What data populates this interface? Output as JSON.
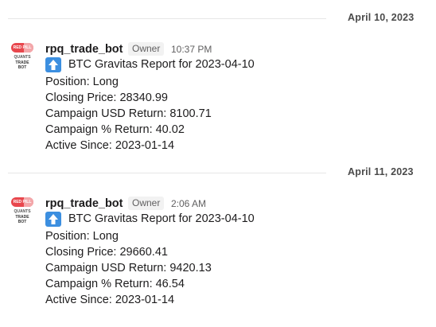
{
  "days": [
    {
      "date": "April 10, 2023",
      "message": {
        "avatar": {
          "top": "RED PILL",
          "line1": "QUANTS",
          "line2": "TRADE",
          "line3": "BOT"
        },
        "sender": "rpq_trade_bot",
        "role": "Owner",
        "time": "10:37 PM",
        "icon": "up-arrow-icon",
        "report_title": "BTC Gravitas Report for 2023-04-10",
        "position": "Position: Long",
        "closing_price": "Closing Price: 28340.99",
        "usd_return": "Campaign USD Return: 8100.71",
        "pct_return": "Campaign % Return: 40.02",
        "active_since": "Active Since: 2023-01-14"
      }
    },
    {
      "date": "April 11, 2023",
      "message": {
        "avatar": {
          "top": "RED PILL",
          "line1": "QUANTS",
          "line2": "TRADE",
          "line3": "BOT"
        },
        "sender": "rpq_trade_bot",
        "role": "Owner",
        "time": "2:06 AM",
        "icon": "up-arrow-icon",
        "report_title": "BTC Gravitas Report for 2023-04-10",
        "position": "Position: Long",
        "closing_price": "Closing Price: 29660.41",
        "usd_return": "Campaign USD Return: 9420.13",
        "pct_return": "Campaign % Return: 46.54",
        "active_since": "Active Since: 2023-01-14"
      }
    }
  ],
  "colors": {
    "icon_blue": "#3c8fe0",
    "avatar_red": "#e8474d",
    "divider": "#e6e6e6"
  }
}
